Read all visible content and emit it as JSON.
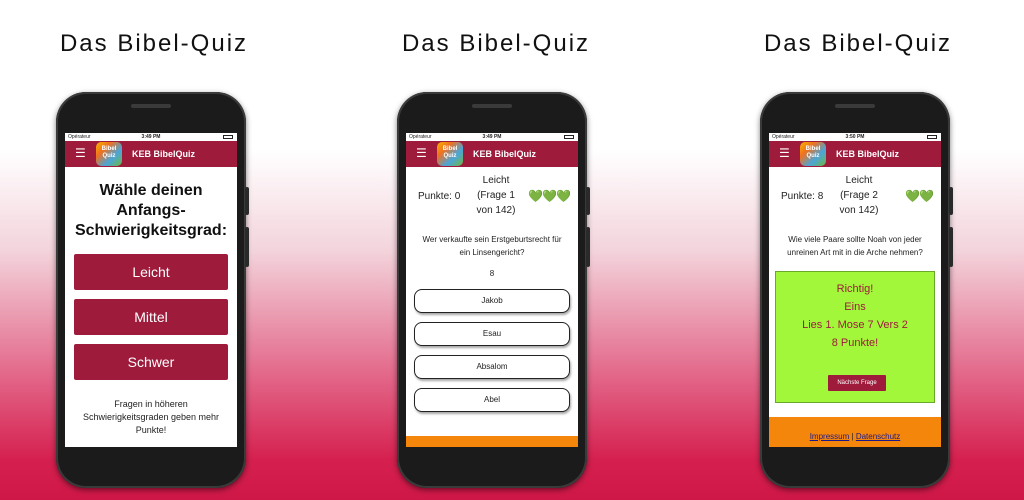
{
  "headings": [
    "Das Bibel-Quiz",
    "Das Bibel-Quiz",
    "Das Bibel-Quiz"
  ],
  "app": {
    "operator": "Opérateur",
    "title": "KEB BibelQuiz",
    "logo_text_top": "Bibel",
    "logo_text_bottom": "Quiz"
  },
  "phone1": {
    "time": "3:49 PM",
    "title": "Wähle deinen Anfangs-Schwierigkeitsgrad:",
    "buttons": [
      "Leicht",
      "Mittel",
      "Schwer"
    ],
    "note": "Fragen in höheren Schwierigkeitsgraden geben mehr Punkte!"
  },
  "phone2": {
    "time": "3:49 PM",
    "score": "Punkte: 0",
    "level_line1": "Leicht",
    "level_line2": "(Frage 1",
    "level_line3": "von 142)",
    "hearts": "💚💚💚",
    "question": "Wer verkaufte sein Erstgeburtsrecht für ein Linsengericht?",
    "qnum": "8",
    "answers": [
      "Jakob",
      "Esau",
      "Absalom",
      "Abel"
    ]
  },
  "phone3": {
    "time": "3:50 PM",
    "score": "Punkte: 8",
    "level_line1": "Leicht",
    "level_line2": "(Frage 2",
    "level_line3": "von 142)",
    "hearts": "💚💚",
    "question": "Wie viele Paare sollte Noah von jeder unreinen Art mit in die Arche nehmen?",
    "result": [
      "Richtig!",
      "Eins",
      "Lies 1. Mose 7 Vers 2",
      "8 Punkte!"
    ],
    "next_button": "Nächste Frage",
    "footer_impressum": "Impressum",
    "footer_sep": "|",
    "footer_datenschutz": "Datenschutz"
  }
}
